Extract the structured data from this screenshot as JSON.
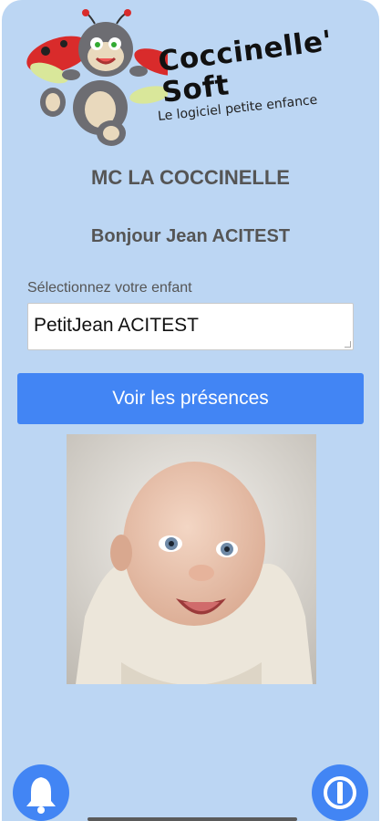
{
  "app": {
    "brand_line1": "Coccinelle'",
    "brand_line2": "Soft",
    "tagline": "Le logiciel petite enfance"
  },
  "header": {
    "daycare_name": "MC LA COCCINELLE",
    "greeting": "Bonjour Jean ACITEST"
  },
  "form": {
    "child_label": "Sélectionnez votre enfant",
    "child_value": "PetitJean ACITEST"
  },
  "actions": {
    "view_presences": "Voir les présences"
  },
  "bottom_bar": {
    "left_icon": "bell-icon",
    "right_icon": "power-icon"
  },
  "colors": {
    "background": "#bcd6f3",
    "primary": "#4285f4",
    "text_muted": "#555555"
  }
}
